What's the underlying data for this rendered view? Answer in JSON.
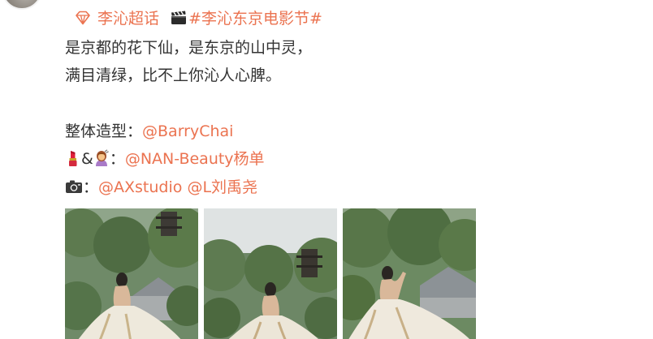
{
  "topic_line": {
    "supertopic_label": "李沁超话",
    "hashtag_label": "#李沁东京电影节#"
  },
  "body": {
    "line1": "是京都的花下仙，是东京的山中灵，",
    "line2": "满目清绿，比不上你沁人心脾。"
  },
  "credits": {
    "styling_label": "整体造型：",
    "styling_mention": "@BarryChai",
    "makeup_sep": "&",
    "makeup_colon": "：",
    "makeup_mention": "@NAN-Beauty杨单",
    "photo_colon": "：",
    "photo_mention_1": "@AXstudio",
    "photo_mention_2": "@L刘禹尧"
  },
  "icons": {
    "supertopic": "diamond-icon",
    "hashtag_prefix": "clapperboard-icon",
    "makeup": "lipstick-icon",
    "hair": "hairdresser-icon",
    "photo": "camera-icon"
  },
  "colors": {
    "link": "#eb7350",
    "text": "#333333"
  }
}
